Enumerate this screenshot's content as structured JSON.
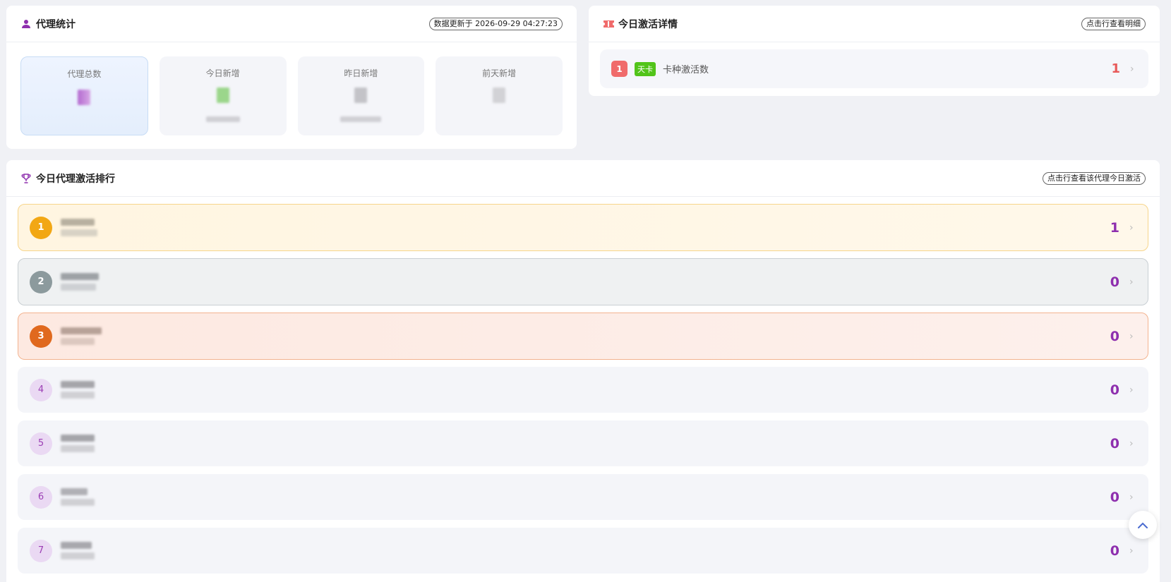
{
  "stats": {
    "title": "代理统计",
    "icon": "user-icon",
    "updated": "数据更新于 2026-09-29 04:27:23",
    "boxes": [
      {
        "label": "代理总数"
      },
      {
        "label": "今日新增"
      },
      {
        "label": "昨日新增"
      },
      {
        "label": "前天新增"
      }
    ]
  },
  "detail": {
    "title": "今日激活详情",
    "icon": "ticket-icon",
    "hint": "点击行查看明细",
    "rows": [
      {
        "rank": "1",
        "tag": "天卡",
        "text": "卡种激活数",
        "count": "1"
      }
    ]
  },
  "ranking": {
    "title": "今日代理激活排行",
    "icon": "trophy-icon",
    "hint": "点击行查看该代理今日激活",
    "rows": [
      {
        "rank": "1",
        "count": "1"
      },
      {
        "rank": "2",
        "count": "0"
      },
      {
        "rank": "3",
        "count": "0"
      },
      {
        "rank": "4",
        "count": "0"
      },
      {
        "rank": "5",
        "count": "0"
      },
      {
        "rank": "6",
        "count": "0"
      },
      {
        "rank": "7",
        "count": "0"
      }
    ]
  },
  "colors": {
    "accent": "#8e2fae",
    "gold": "#f2a714",
    "silver": "#8c9a9d",
    "bronze": "#e0691e",
    "red": "#e85a5a",
    "green": "#52c41a"
  }
}
